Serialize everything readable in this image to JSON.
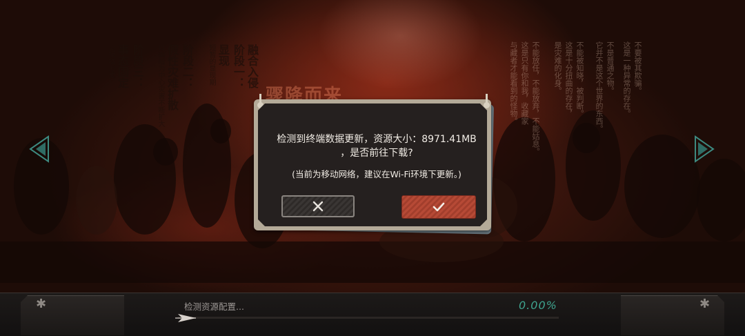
{
  "background": {
    "faded_title": "骤降而来",
    "left_text_columns": [
      {
        "title": "融合入侵",
        "sub": ""
      },
      {
        "title": "阶段一：",
        "sub": ""
      },
      {
        "title": "显现",
        "sub": "短暂的显现期"
      },
      {
        "title": "阶段二：",
        "sub": ""
      },
      {
        "title": "假性灾难扩散",
        "sub": "以幽暗为中心灾害不断扩大"
      },
      {
        "title": "阶段三：",
        "sub": ""
      },
      {
        "title": "事态固定",
        "sub": "灾祸被形成"
      }
    ],
    "right_text_columns": [
      "不能放任，不能放弃，不能姑息。",
      "这是只有你和我，收藏家",
      "与藏者才能看到的怪物。",
      "是灾难的化身。",
      "这是十分扭曲的存在，",
      "不能被知晓，被判断。",
      "它并不是这个世界的东西。",
      "不是普通之物。",
      "这是一种异常的存在。",
      "不要被其欺骗。"
    ]
  },
  "dialog": {
    "message_line1": "检测到终端数据更新，资源大小：8971.41MB",
    "message_line2": "，是否前往下载?",
    "note": "(当前为移动网络，建议在Wi-Fi环境下更新。)",
    "cancel_icon": "close-icon",
    "confirm_icon": "check-icon"
  },
  "nav": {
    "left_icon": "arrow-left-icon",
    "right_icon": "arrow-right-icon"
  },
  "bottom_bar": {
    "status": "检测资源配置...",
    "progress_label": "0.00%",
    "progress_value": 0.0,
    "accent_color": "#3fa48f"
  },
  "colors": {
    "confirm_button": "#b64a36",
    "dialog_background": "#25201f",
    "dialog_frame": "#b4aa98"
  }
}
